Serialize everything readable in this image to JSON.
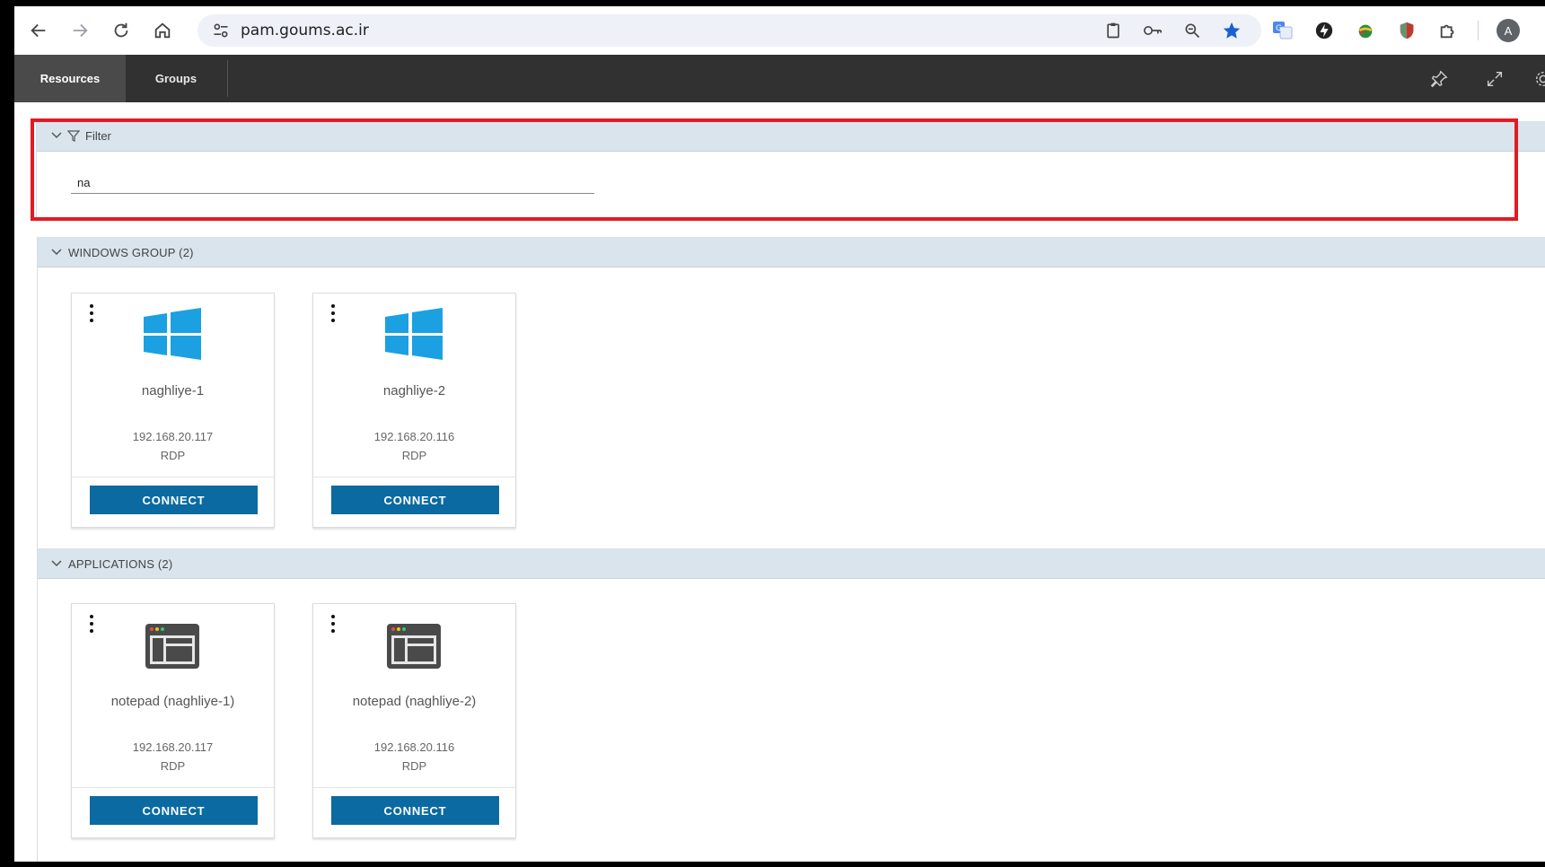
{
  "browser": {
    "url": "pam.goums.ac.ir",
    "profile_initial": "A"
  },
  "app": {
    "tabs": [
      {
        "label": "Resources",
        "active": true
      },
      {
        "label": "Groups",
        "active": false
      }
    ]
  },
  "filter": {
    "label": "Filter",
    "value": "na"
  },
  "groups": [
    {
      "title": "WINDOWS GROUP (2)",
      "icon": "windows-logo-icon",
      "cards": [
        {
          "name": "naghliye-1",
          "ip": "192.168.20.117",
          "protocol": "RDP",
          "button": "CONNECT"
        },
        {
          "name": "naghliye-2",
          "ip": "192.168.20.116",
          "protocol": "RDP",
          "button": "CONNECT"
        }
      ]
    },
    {
      "title": "APPLICATIONS (2)",
      "icon": "application-window-icon",
      "cards": [
        {
          "name": "notepad (naghliye-1)",
          "ip": "192.168.20.117",
          "protocol": "RDP",
          "button": "CONNECT"
        },
        {
          "name": "notepad (naghliye-2)",
          "ip": "192.168.20.116",
          "protocol": "RDP",
          "button": "CONNECT"
        }
      ]
    }
  ],
  "colors": {
    "header_bg": "#313131",
    "section_header_bg": "#d9e4ec",
    "connect_button": "#0a6aa1",
    "windows_blue": "#1ba1e2",
    "highlight_red": "#e01b24"
  }
}
